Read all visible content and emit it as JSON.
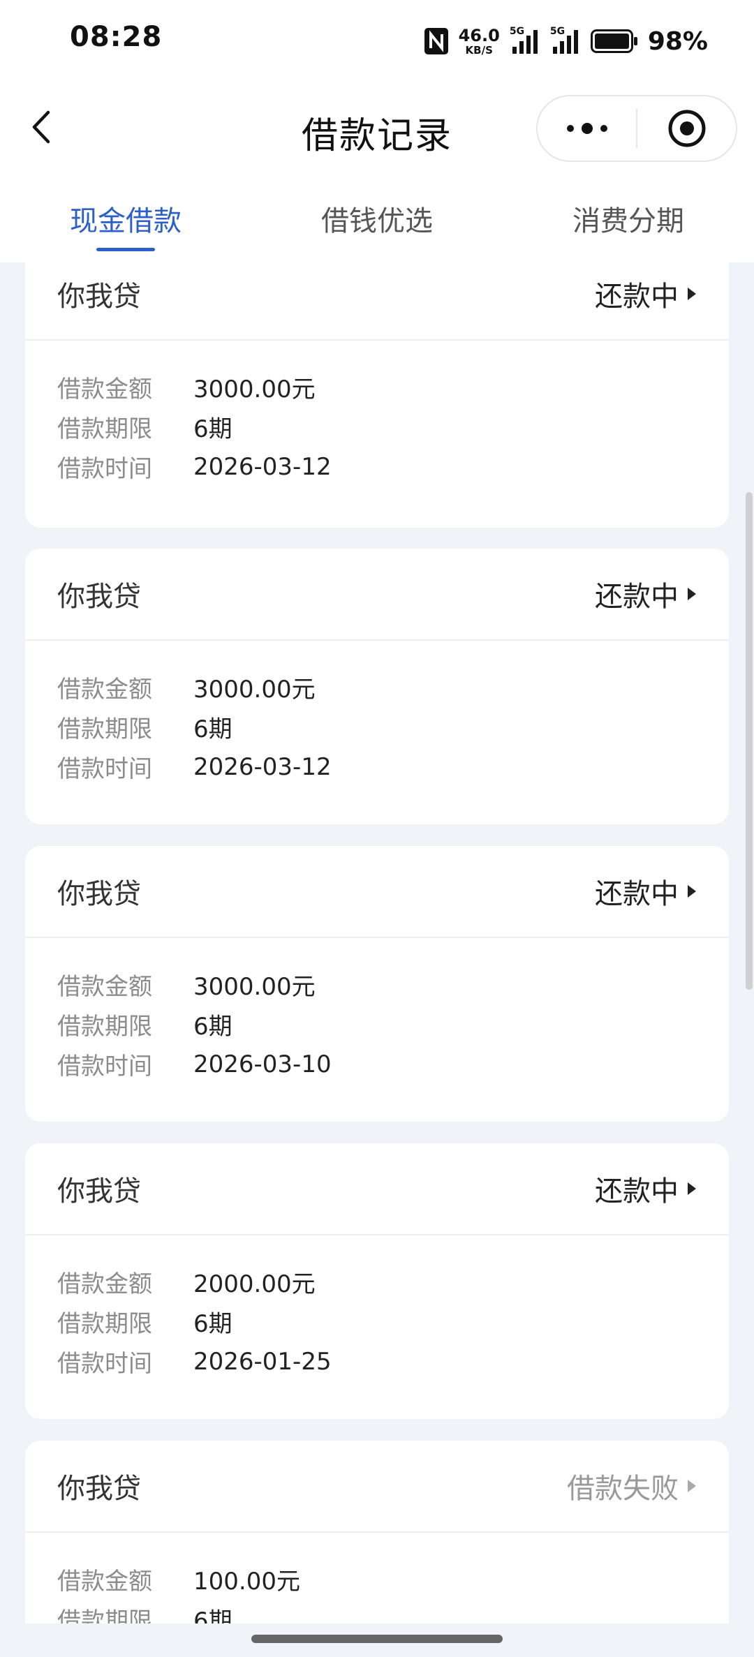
{
  "status_bar": {
    "time": "08:28",
    "net_speed": "46.0",
    "net_unit": "KB/S",
    "sim1": "5G",
    "sim2": "5G",
    "battery": "98%"
  },
  "nav": {
    "title": "借款记录",
    "icons": {
      "back": "chevron-left-icon",
      "more": "more-dots-icon",
      "close": "target-icon"
    }
  },
  "tabs": [
    {
      "label": "现金借款",
      "active": true
    },
    {
      "label": "借钱优选",
      "active": false
    },
    {
      "label": "消费分期",
      "active": false
    }
  ],
  "labels": {
    "amount": "借款金额",
    "term": "借款期限",
    "time": "借款时间"
  },
  "loans": [
    {
      "lender": "你我贷",
      "status": "还款中",
      "amount": "3000.00元",
      "term": "6期",
      "date": "2026-03-12"
    },
    {
      "lender": "你我贷",
      "status": "还款中",
      "amount": "3000.00元",
      "term": "6期",
      "date": "2026-03-12"
    },
    {
      "lender": "你我贷",
      "status": "还款中",
      "amount": "3000.00元",
      "term": "6期",
      "date": "2026-03-10"
    },
    {
      "lender": "你我贷",
      "status": "还款中",
      "amount": "2000.00元",
      "term": "6期",
      "date": "2026-01-25"
    },
    {
      "lender": "你我贷",
      "status": "借款失败",
      "amount": "100.00元",
      "term": "6期",
      "date": ""
    }
  ],
  "colors": {
    "accent": "#2c5fc8",
    "fail": "#999999"
  }
}
